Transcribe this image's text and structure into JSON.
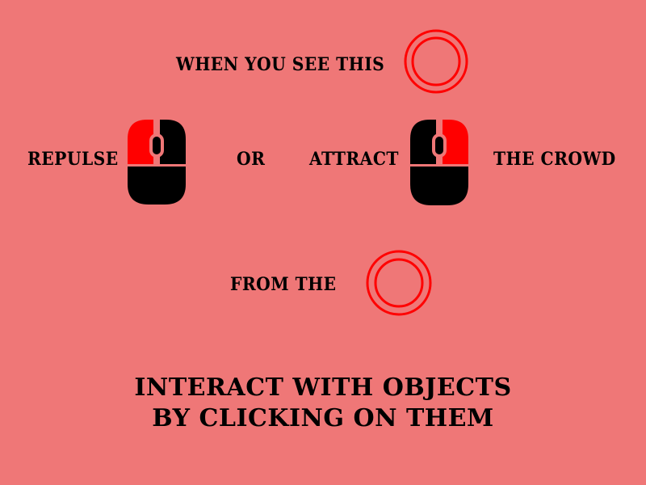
{
  "instructions": {
    "line1": "WHEN YOU SEE THIS",
    "repulse": "REPULSE",
    "or": "OR",
    "attract": "ATTRACT",
    "the_crowd": "THE CROWD",
    "from_the": "FROM THE",
    "bottom_line1": "INTERACT WITH OBJECTS",
    "bottom_line2": "BY CLICKING ON THEM"
  },
  "colors": {
    "background": "#ef7777",
    "accent": "#ff0000",
    "ink": "#000000"
  },
  "icons": [
    "target-ring-icon",
    "mouse-left-click-icon",
    "mouse-right-click-icon",
    "target-ring-icon"
  ]
}
